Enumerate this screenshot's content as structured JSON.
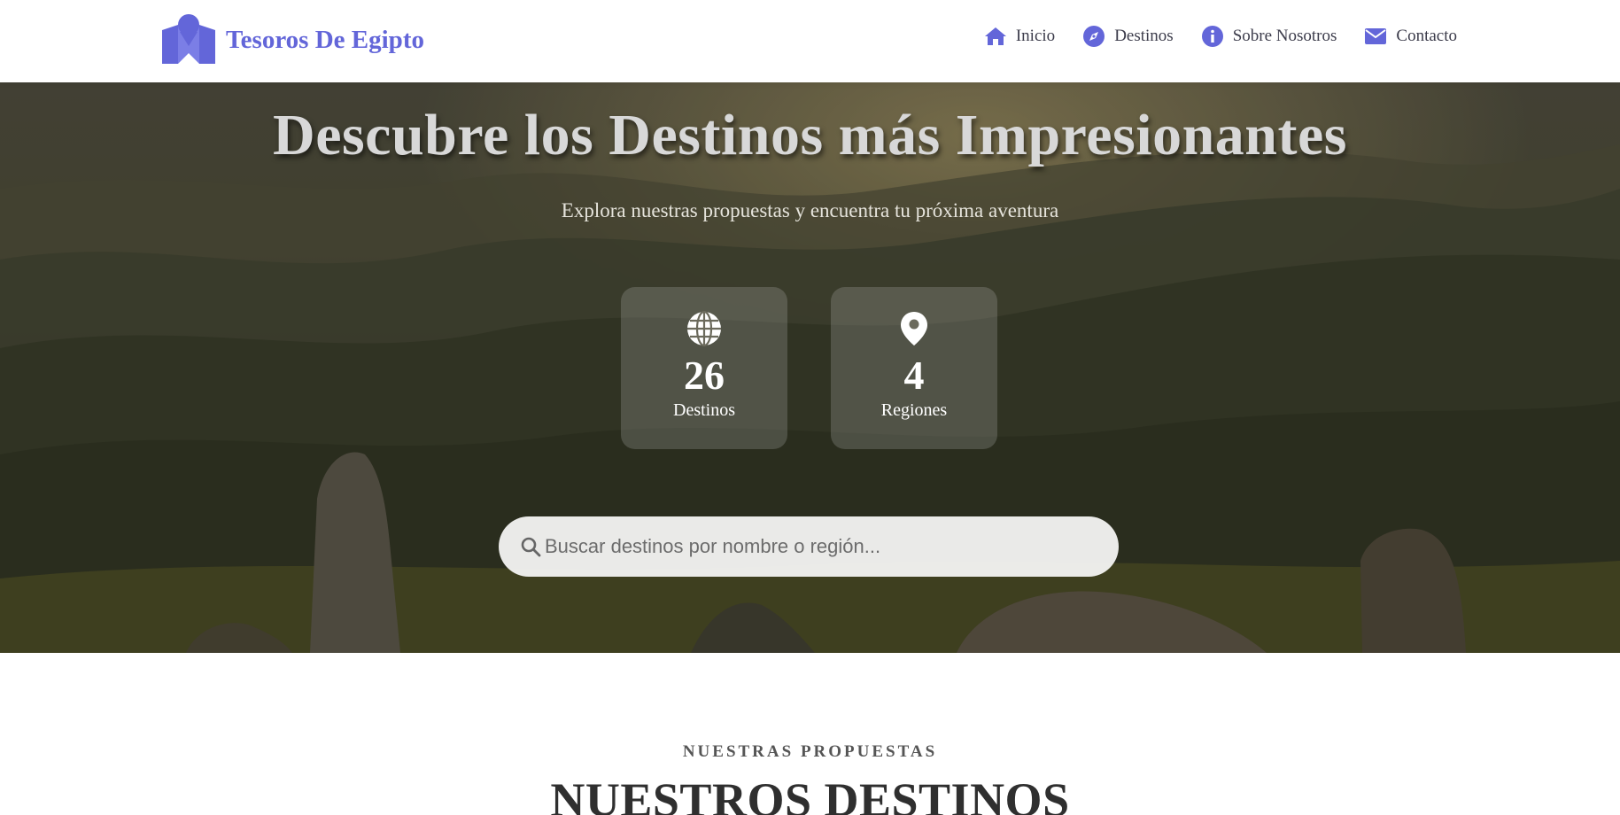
{
  "brand": {
    "name": "Tesoros De Egipto",
    "logo_icon": "map-marker-logo",
    "color": "#6366d9"
  },
  "nav": {
    "items": [
      {
        "label": "Inicio",
        "icon": "home-icon"
      },
      {
        "label": "Destinos",
        "icon": "compass-icon"
      },
      {
        "label": "Sobre Nosotros",
        "icon": "info-icon"
      },
      {
        "label": "Contacto",
        "icon": "envelope-icon"
      }
    ],
    "icon_color": "#6366d9"
  },
  "hero": {
    "title": "Descubre los Destinos más Impresionantes",
    "subtitle": "Explora nuestras propuestas y encuentra tu próxima aventura",
    "stats": [
      {
        "value": "26",
        "label": "Destinos",
        "icon": "globe-icon"
      },
      {
        "value": "4",
        "label": "Regiones",
        "icon": "map-pin-icon"
      }
    ],
    "search": {
      "placeholder": "Buscar destinos por nombre o región...",
      "value": ""
    }
  },
  "section": {
    "eyebrow": "NUESTRAS PROPUESTAS",
    "title": "NUESTROS DESTINOS"
  }
}
